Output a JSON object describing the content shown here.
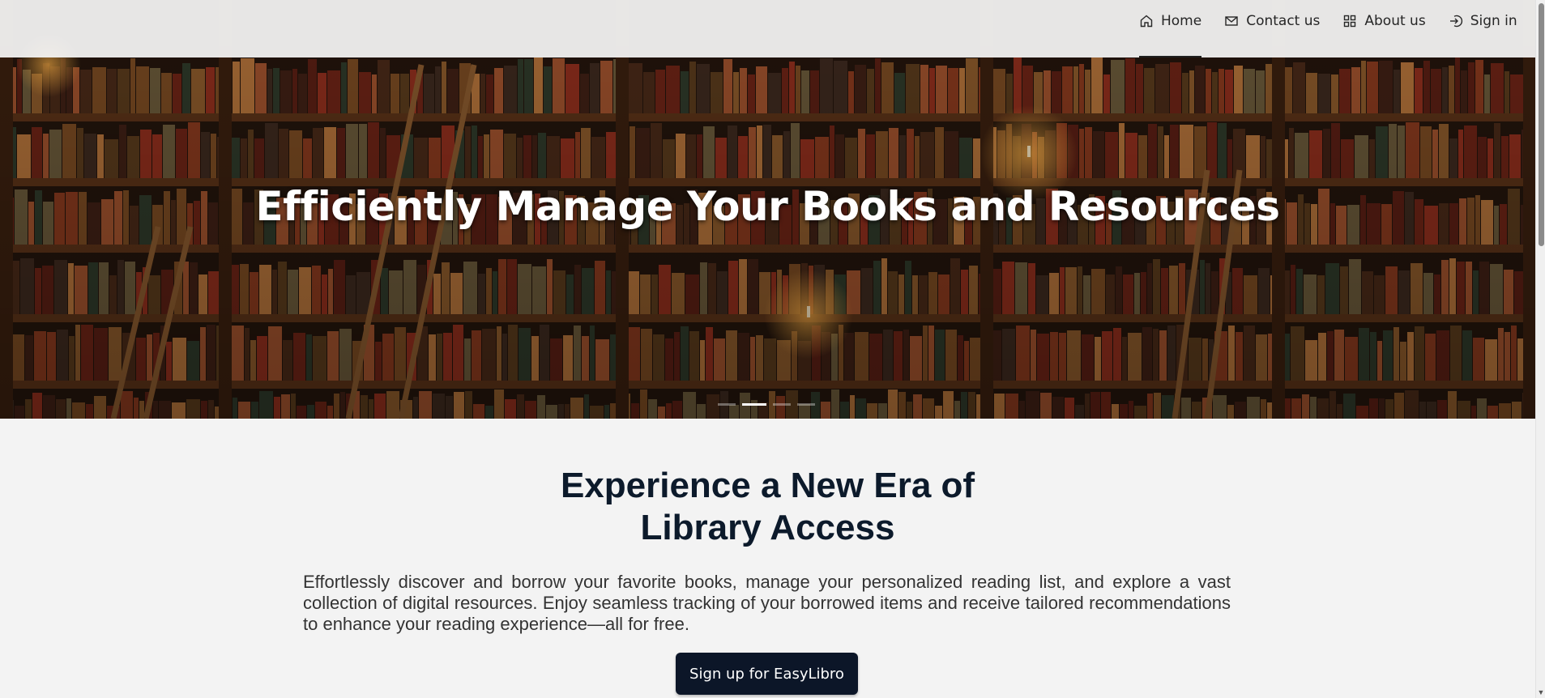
{
  "nav": {
    "items": [
      {
        "label": "Home",
        "icon": "home-icon",
        "active": true
      },
      {
        "label": "Contact us",
        "icon": "mail-icon",
        "active": false
      },
      {
        "label": "About us",
        "icon": "grid-icon",
        "active": false
      },
      {
        "label": "Sign in",
        "icon": "sign-in-icon",
        "active": false
      }
    ]
  },
  "hero": {
    "title": "Efficiently Manage Your Books and Resources",
    "slides": 4,
    "active_slide": 2
  },
  "main": {
    "headline_line1": "Experience a New Era of",
    "headline_line2": "Library Access",
    "description": "Effortlessly discover and borrow your favorite books, manage your personalized reading list, and explore a vast collection of digital resources. Enjoy seamless tracking of your borrowed items and receive tailored recommendations to enhance your reading experience—all for free.",
    "signup_label": "Sign up for EasyLibro"
  },
  "colors": {
    "button_bg": "#0c1628",
    "headline": "#0c1a2b",
    "page_bg": "#f3f3f3"
  }
}
